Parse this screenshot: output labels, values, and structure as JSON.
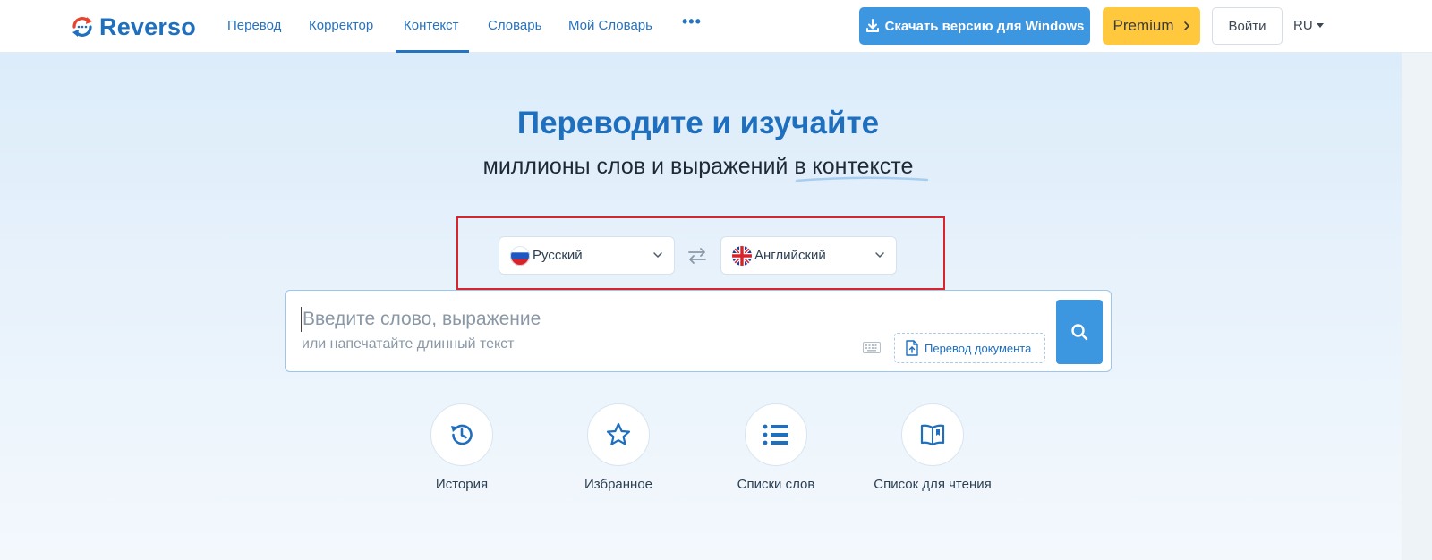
{
  "header": {
    "logo_text": "Reverso",
    "nav": [
      {
        "label": "Перевод"
      },
      {
        "label": "Корректор"
      },
      {
        "label": "Контекст",
        "active": true
      },
      {
        "label": "Словарь"
      },
      {
        "label": "Мой Словарь"
      }
    ],
    "more_label": "•••",
    "download_label": "Скачать версию для Windows",
    "premium_label": "Premium",
    "login_label": "Войти",
    "lang_label": "RU"
  },
  "hero": {
    "title": "Переводите и изучайте",
    "subtitle_start": "миллионы слов и выражений ",
    "subtitle_highlight": "в контексте"
  },
  "languages": {
    "source": "Русский",
    "target": "Английский"
  },
  "search": {
    "placeholder": "Введите слово, выражение",
    "hint": "или напечатайте длинный текст",
    "doc_button": "Перевод документа"
  },
  "quick_actions": [
    {
      "label": "История",
      "icon": "history-icon"
    },
    {
      "label": "Избранное",
      "icon": "star-icon"
    },
    {
      "label": "Списки слов",
      "icon": "list-icon"
    },
    {
      "label": "Список для чтения",
      "icon": "book-icon"
    }
  ],
  "colors": {
    "brand_blue": "#1f6fbf",
    "button_blue": "#3d96e0",
    "premium_yellow": "#ffc83d",
    "highlight_red": "#d9232d"
  }
}
